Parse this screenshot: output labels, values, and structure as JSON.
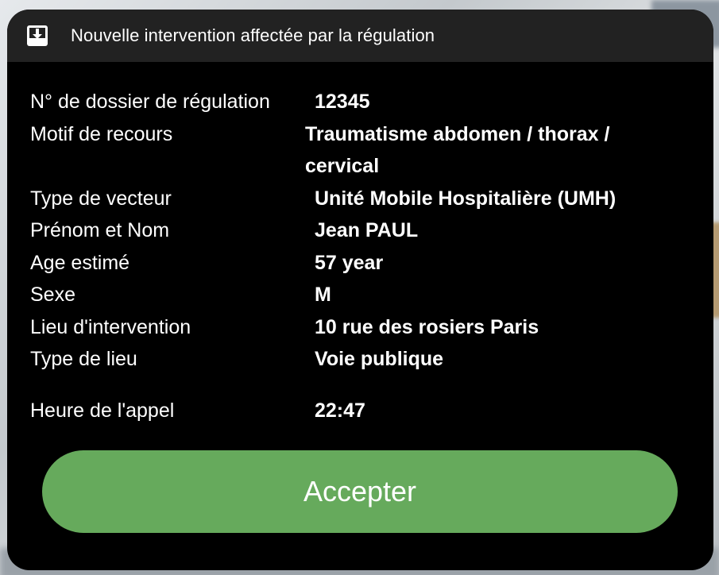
{
  "header": {
    "title": "Nouvelle intervention affectée par la régulation",
    "icon": "download-box-icon"
  },
  "details": [
    {
      "label": "N° de dossier de régulation",
      "value": "12345"
    },
    {
      "label": "Motif de recours",
      "value": "Traumatisme abdomen / thorax / cervical"
    },
    {
      "label": "Type de vecteur",
      "value": "Unité Mobile Hospitalière (UMH)"
    },
    {
      "label": "Prénom et Nom",
      "value": "Jean PAUL"
    },
    {
      "label": "Age estimé",
      "value": "57 year"
    },
    {
      "label": "Sexe",
      "value": "M"
    },
    {
      "label": "Lieu d'intervention",
      "value": "10 rue des rosiers Paris"
    },
    {
      "label": "Type de lieu",
      "value": "Voie publique"
    },
    {
      "label": "Heure de l'appel",
      "value": "22:47"
    }
  ],
  "actions": {
    "accept_label": "Accepter"
  },
  "colors": {
    "card_background": "#000000",
    "header_background": "#222222",
    "accept_button": "#66aa5c",
    "text": "#ffffff"
  }
}
